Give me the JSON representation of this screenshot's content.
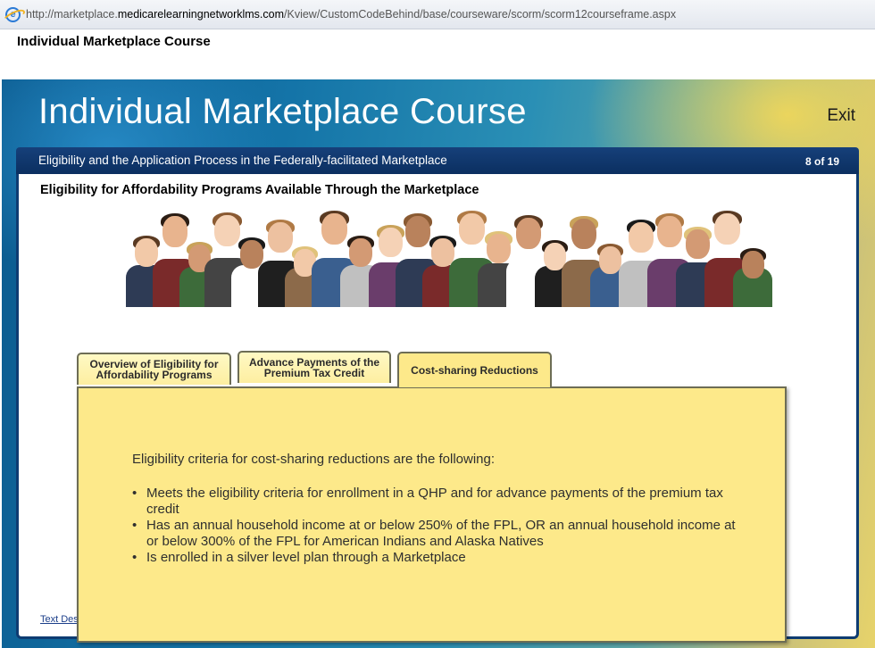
{
  "browser": {
    "url_prefix": "http://marketplace.",
    "url_domain": "medicarelearningnetworklms.com",
    "url_path": "/Kview/CustomCodeBehind/base/courseware/scorm/scorm12courseframe.aspx",
    "icon": "ie-icon"
  },
  "window": {
    "title": "Individual Marketplace Course"
  },
  "course": {
    "title": "Individual Marketplace Course",
    "exit_label": "Exit",
    "subtitle": "Eligibility and the Application Process in the Federally-facilitated Marketplace",
    "page_count": "8 of 19"
  },
  "content": {
    "heading": "Eligibility for Affordability Programs Available Through the Marketplace",
    "tabs": [
      {
        "label_line1": "Overview of Eligibility for",
        "label_line2": "Affordability Programs",
        "active": false
      },
      {
        "label_line1": "Advance Payments of the",
        "label_line2": "Premium Tax Credit",
        "active": false
      },
      {
        "label_line1": "Cost-sharing Reductions",
        "label_line2": "",
        "active": true
      }
    ],
    "intro": "Eligibility criteria for cost-sharing reductions are the following:",
    "bullets": [
      "Meets the eligibility criteria for enrollment in a QHP and for advance payments of the premium tax credit",
      "Has an annual household income at or below 250% of the FPL, OR an annual household income at or below 300% of the FPL for American Indians and Alaska Natives",
      "Is enrolled in a silver level plan through a Marketplace"
    ],
    "link_text": "Text Description of Image or Animation"
  },
  "colors": {
    "header_bar": "#0b2f60",
    "card_fill": "#fde98a",
    "tab_fill": "#fff9c4",
    "link": "#1c3f8a"
  }
}
